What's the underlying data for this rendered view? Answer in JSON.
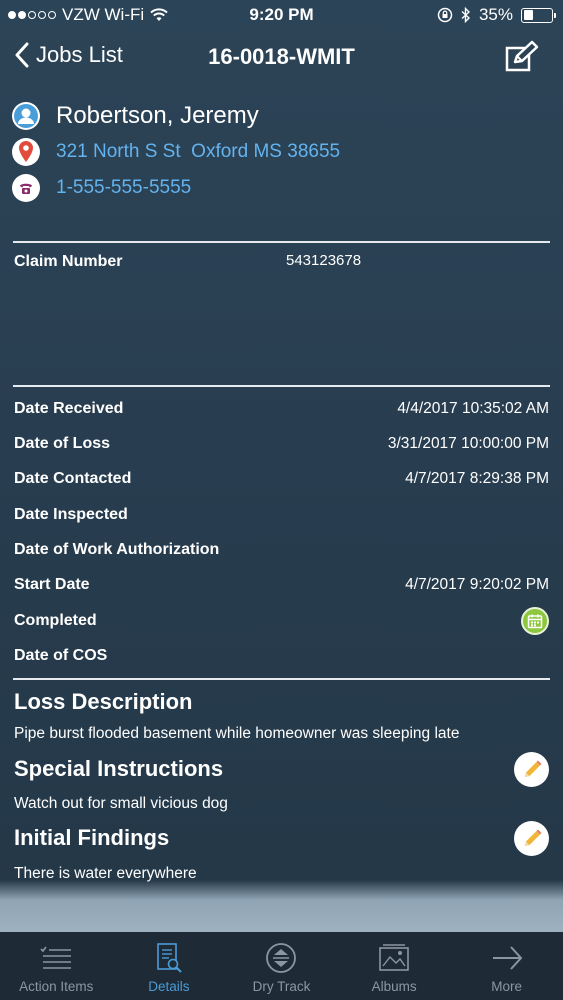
{
  "status_bar": {
    "carrier": "VZW Wi-Fi",
    "time": "9:20 PM",
    "battery": "35%",
    "battery_level": 0.35
  },
  "nav": {
    "back_label": "Jobs List",
    "title": "16-0018-WMIT"
  },
  "contact": {
    "name": "Robertson, Jeremy",
    "address": "321 North S St  Oxford MS 38655",
    "phone": "1-555-555-5555"
  },
  "claim": {
    "label": "Claim Number",
    "value": "543123678"
  },
  "dates": [
    {
      "label": "Date Received",
      "value": "4/4/2017 10:35:02 AM"
    },
    {
      "label": "Date of Loss",
      "value": "3/31/2017 10:00:00 PM"
    },
    {
      "label": "Date Contacted",
      "value": "4/7/2017 8:29:38 PM"
    },
    {
      "label": "Date Inspected",
      "value": ""
    },
    {
      "label": "Date of Work Authorization",
      "value": ""
    },
    {
      "label": "Start Date",
      "value": "4/7/2017 9:20:02 PM"
    },
    {
      "label": "Completed",
      "value": ""
    },
    {
      "label": "Date of COS",
      "value": ""
    }
  ],
  "sections": {
    "loss_description": {
      "title": "Loss Description",
      "text": "Pipe burst flooded basement while homeowner was sleeping late"
    },
    "special_instructions": {
      "title": "Special Instructions",
      "text": "Watch out for small vicious dog"
    },
    "initial_findings": {
      "title": "Initial Findings",
      "text": "There is water everywhere"
    }
  },
  "tabs": [
    {
      "label": "Action Items",
      "icon": "list-icon"
    },
    {
      "label": "Details",
      "icon": "document-search-icon",
      "active": true
    },
    {
      "label": "Dry Track",
      "icon": "compass-icon"
    },
    {
      "label": "Albums",
      "icon": "photo-album-icon"
    },
    {
      "label": "More",
      "icon": "arrow-right-icon"
    }
  ],
  "colors": {
    "link": "#63b3ee",
    "active_tab": "#4b9bd6",
    "calendar_green": "#8dc63f"
  }
}
